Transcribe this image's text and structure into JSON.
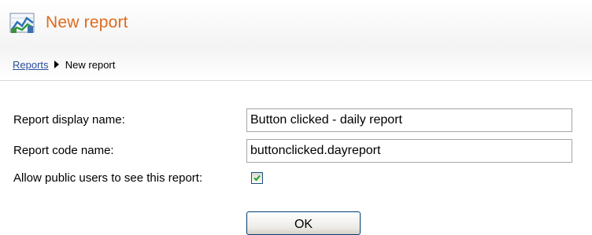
{
  "header": {
    "title": "New report",
    "icon": "report-chart-icon",
    "title_color": "#e06a1c"
  },
  "breadcrumb": {
    "parent_label": "Reports",
    "current_label": "New report",
    "link_color": "#2b4ea0"
  },
  "form": {
    "display_name_label": "Report display name:",
    "display_name_value": "Button clicked - daily report",
    "code_name_label": "Report code name:",
    "code_name_value": "buttonclicked.dayreport",
    "public_label": "Allow public users to see this report:",
    "public_checked": true,
    "ok_label": "OK"
  }
}
